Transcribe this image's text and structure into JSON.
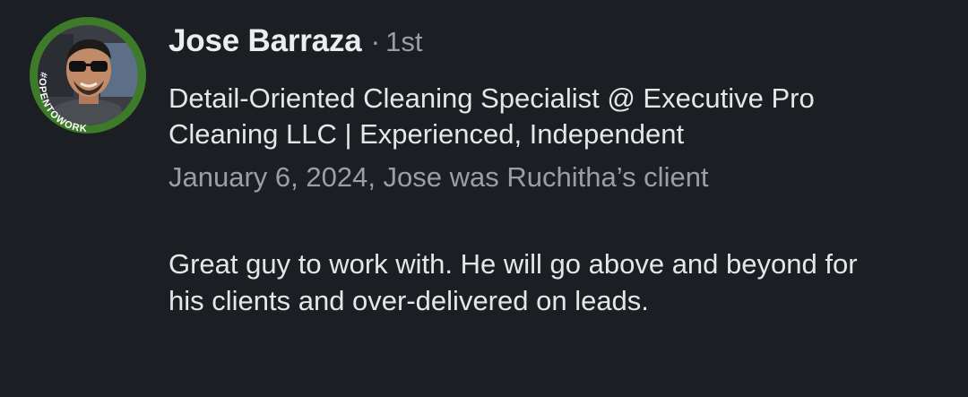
{
  "recommendation": {
    "author_name": "Jose Barraza",
    "separator": "·",
    "connection_degree": "1st",
    "headline": "Detail-Oriented Cleaning Specialist @ Executive Pro Cleaning LLC | Experienced, Independent",
    "meta": "January 6, 2024, Jose was Ruchitha’s client",
    "text": "Great guy to work with. He will go above and beyond for his clients and over-delivered on leads.",
    "avatar_badge": "#OPENTOWORK",
    "badge_color": "#3d7a2a"
  }
}
